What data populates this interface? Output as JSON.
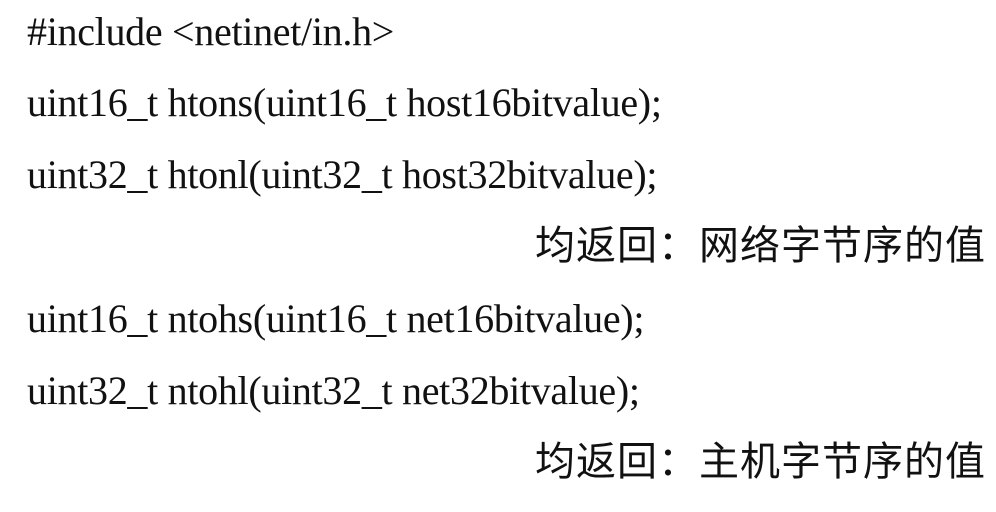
{
  "document": {
    "include_line": "#include <netinet/in.h>",
    "htons_line": "uint16_t htons(uint16_t host16bitvalue);",
    "htonl_line": "uint32_t htonl(uint32_t host32bitvalue);",
    "network_note": "均返回：网络字节序的值",
    "ntohs_line": "uint16_t ntohs(uint16_t net16bitvalue);",
    "ntohl_line": "uint32_t ntohl(uint32_t net32bitvalue);",
    "host_note": "均返回：主机字节序的值"
  }
}
